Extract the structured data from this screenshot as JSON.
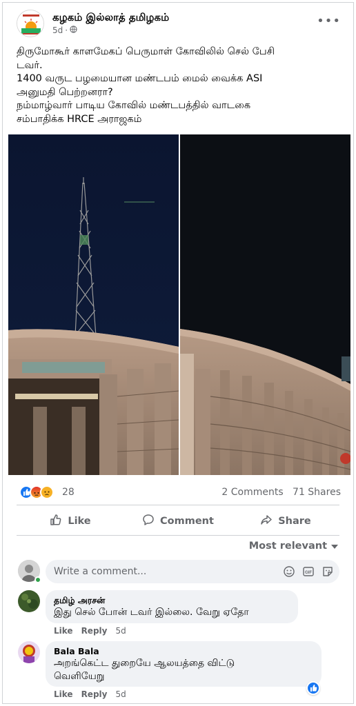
{
  "post": {
    "page_name": "கழகம் இல்லாத் தமிழகம்",
    "time": "5d",
    "privacy_icon": "globe-icon",
    "more_icon": "ellipsis-icon",
    "lines": [
      "திருமோகூர் காளமேகப் பெருமாள் கோவிலில் செல் பேசி",
      "டவர்.",
      "1400 வருட பழமையான மண்டபம் மைல் வைக்க ASI",
      "அனுமதி பெற்றனரா?",
      "நம்மாழ்வார் பாடிய கோவில் மண்டபத்தில் வாடகை",
      "சம்பாதிக்க HRCE அராஜகம்"
    ]
  },
  "stats": {
    "reaction_count": "28",
    "comments": "2 Comments",
    "shares": "71 Shares",
    "reaction_icons": [
      "like-icon",
      "angry-icon",
      "sad-icon"
    ]
  },
  "actions": {
    "like": "Like",
    "comment": "Comment",
    "share": "Share"
  },
  "sort": {
    "label": "Most relevant"
  },
  "composer": {
    "placeholder": "Write a comment..."
  },
  "comments": [
    {
      "author": "தமிழ் அரசன்",
      "text": "இது செல் போன் டவர் இல்லை. வேறு ஏதோ",
      "like": "Like",
      "reply": "Reply",
      "time": "5d"
    },
    {
      "author": "Bala Bala",
      "text": "அறங்கெட்ட துறையே ஆலயத்தை விட்டு\nவெளியேறு",
      "like": "Like",
      "reply": "Reply",
      "time": "5d"
    }
  ],
  "colors": {
    "like_blue": "#1877f2",
    "angry": "#f0692f",
    "sad": "#f7b125",
    "secondary_text": "#65676b"
  }
}
